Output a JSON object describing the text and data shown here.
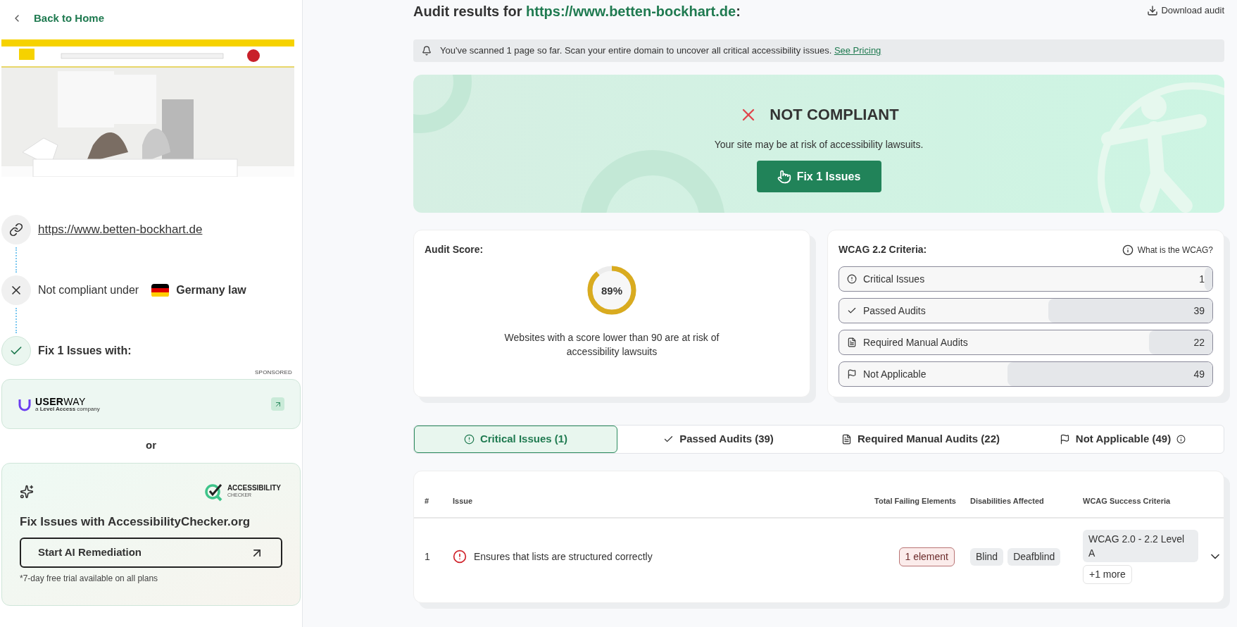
{
  "sidebar": {
    "back_link": "Back to Home",
    "steps": [
      {
        "kind": "link",
        "text": "https://www.betten-bockhart.de"
      },
      {
        "kind": "fail",
        "text": "Not compliant under",
        "law": "Germany law"
      },
      {
        "kind": "pass",
        "text": "Fix 1 Issues with:"
      }
    ],
    "sponsored_label": "SPONSORED",
    "userway": {
      "name": "**USER**WAY",
      "tagline": "a **Level Access** company"
    },
    "or_label": "or",
    "checker": {
      "logo_top": "ACCESSIBILITY",
      "logo_bottom": "CHECKER",
      "title": "Fix Issues with AccessibilityChecker.org",
      "button": "Start AI Remediation",
      "note": "*7-day free trial available on all plans"
    }
  },
  "header": {
    "title_prefix": "Audit results for",
    "url": "https://www.betten-bockhart.de",
    "title_suffix": ":",
    "download": "Download audit"
  },
  "notice": {
    "text": "You've scanned 1 page so far. Scan your entire domain to uncover all critical accessibility issues.",
    "link": "See Pricing"
  },
  "banner": {
    "status": "NOT COMPLIANT",
    "compliant": false,
    "message": "Your site may be at risk of accessibility lawsuits.",
    "button": "Fix 1 Issues"
  },
  "score_card": {
    "title": "Audit Score:",
    "score": "89%",
    "level": 0.89,
    "caption": "Websites with a score lower than 90 are at risk of accessibility lawsuits"
  },
  "criteria_card": {
    "title": "WCAG 2.2 Criteria:",
    "help": "What is the WCAG?",
    "items": [
      {
        "kind": "critical",
        "label": "Critical Issues",
        "count": "1",
        "level": 0.02
      },
      {
        "kind": "passed",
        "label": "Passed Audits",
        "count": "39",
        "level": 0.44
      },
      {
        "kind": "manual",
        "label": "Required Manual Audits",
        "count": "22",
        "level": 0.17
      },
      {
        "kind": "na",
        "label": "Not Applicable",
        "count": "49",
        "level": 0.55
      }
    ]
  },
  "tabs": [
    {
      "kind": "critical",
      "label": "Critical Issues (1)",
      "selected": true,
      "info": false
    },
    {
      "kind": "passed",
      "label": "Passed Audits (39)",
      "selected": false,
      "info": false
    },
    {
      "kind": "manual",
      "label": "Required Manual Audits (22)",
      "selected": false,
      "info": false
    },
    {
      "kind": "na",
      "label": "Not Applicable (49)",
      "selected": false,
      "info": true
    }
  ],
  "table": {
    "columns": [
      "#",
      "Issue",
      "Total Failing Elements",
      "Disabilities Affected",
      "WCAG Success Criteria"
    ],
    "rows": [
      {
        "number": "1",
        "issue": "Ensures that lists are structured correctly",
        "failing": "1 element",
        "disabilities": [
          "Blind",
          "Deafblind"
        ],
        "criteria": [
          "WCAG 2.0 - 2.2 Level A"
        ],
        "more": "+1 more",
        "expanded": false
      }
    ]
  }
}
